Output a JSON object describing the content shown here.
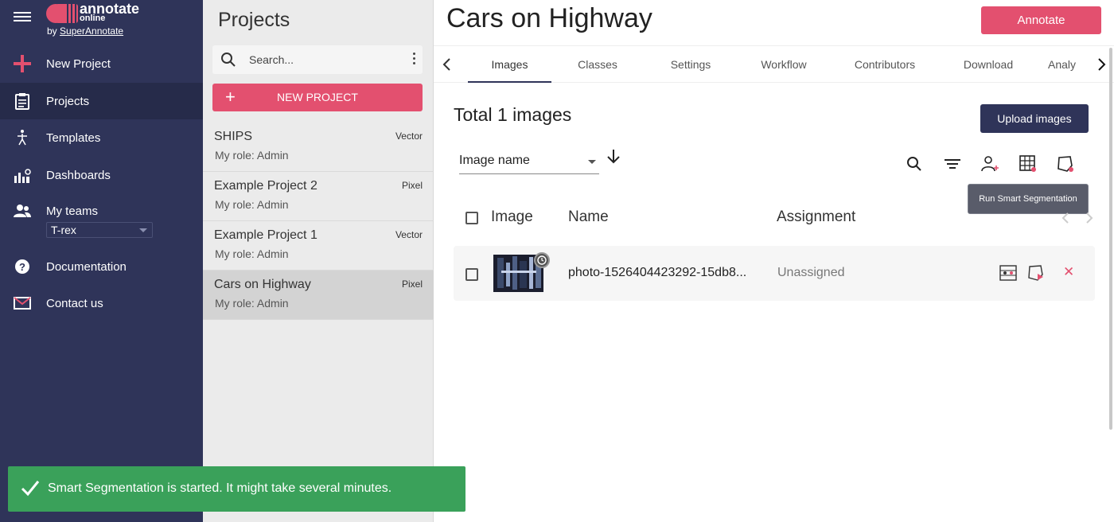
{
  "brand": {
    "name": "annotate",
    "sub": "online",
    "by_prefix": "by",
    "by_link": "SuperAnnotate"
  },
  "sidebar": {
    "items": [
      {
        "label": "New Project",
        "icon": "plus-icon"
      },
      {
        "label": "Projects",
        "icon": "clipboard-icon"
      },
      {
        "label": "Templates",
        "icon": "templates-icon"
      },
      {
        "label": "Dashboards",
        "icon": "dashboard-icon"
      },
      {
        "label": "My teams",
        "icon": "team-icon"
      },
      {
        "label": "Documentation",
        "icon": "help-icon"
      },
      {
        "label": "Contact us",
        "icon": "mail-icon"
      }
    ],
    "team_selected": "T-rex"
  },
  "projects_panel": {
    "title": "Projects",
    "search_placeholder": "Search...",
    "new_project_label": "NEW PROJECT",
    "list": [
      {
        "name": "SHIPS",
        "role": "My role: Admin",
        "type": "Vector"
      },
      {
        "name": "Example Project 2",
        "role": "My role: Admin",
        "type": "Pixel"
      },
      {
        "name": "Example Project 1",
        "role": "My role: Admin",
        "type": "Vector"
      },
      {
        "name": "Cars on Highway",
        "role": "My role: Admin",
        "type": "Pixel"
      }
    ]
  },
  "main": {
    "title": "Cars on Highway",
    "annotate_label": "Annotate",
    "tabs": [
      "Images",
      "Classes",
      "Settings",
      "Workflow",
      "Contributors",
      "Download",
      "Analy"
    ],
    "total_label": "Total 1 images",
    "upload_label": "Upload images",
    "sort_label": "Image name",
    "tooltip": "Run Smart Segmentation",
    "columns": [
      "Image",
      "Name",
      "Assignment"
    ],
    "rows": [
      {
        "name": "photo-1526404423292-15db8...",
        "assignment": "Unassigned"
      }
    ]
  },
  "toast": {
    "message": "Smart Segmentation is started. It might take several minutes."
  },
  "colors": {
    "sidebar": "#2f3459",
    "accent": "#e3506f",
    "success": "#3aa15a"
  }
}
